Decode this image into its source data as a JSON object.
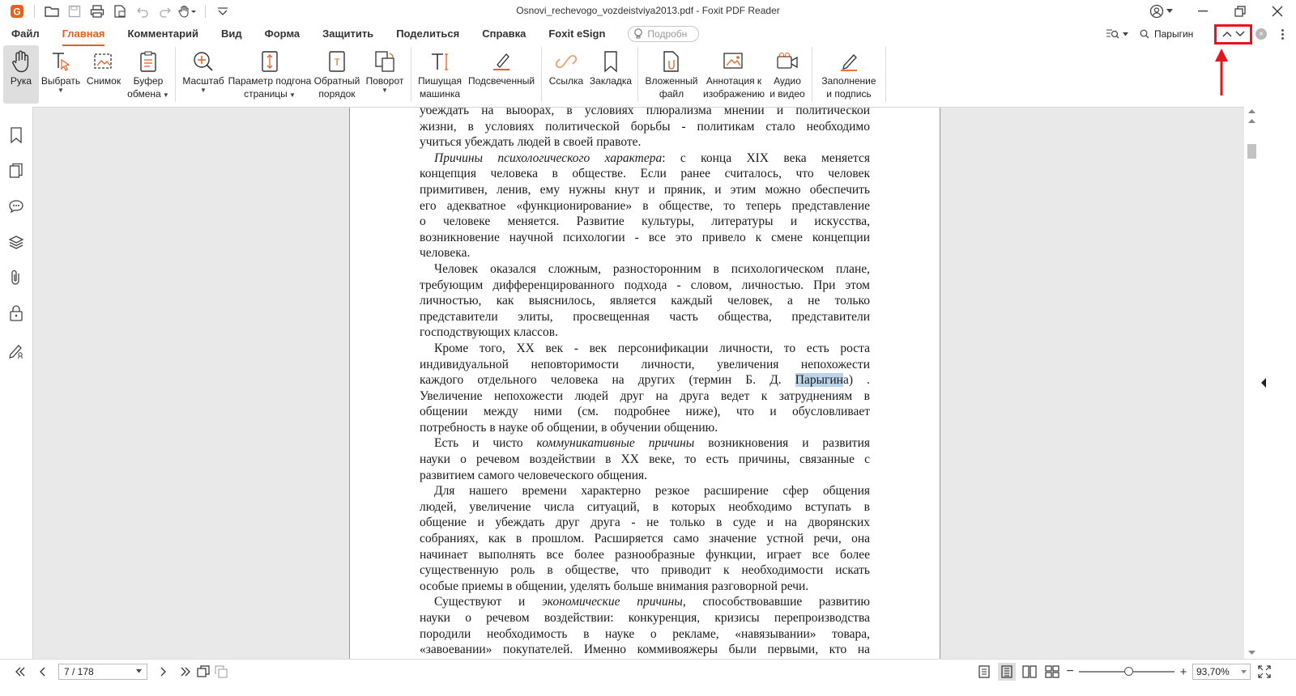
{
  "window": {
    "title": "Osnovi_rechevogo_vozdeistviya2013.pdf - Foxit PDF Reader",
    "app_icon": "foxit-logo-icon",
    "accent": "#e8601c"
  },
  "menu": {
    "items": [
      "Файл",
      "Главная",
      "Комментарий",
      "Вид",
      "Форма",
      "Защитить",
      "Поделиться",
      "Справка",
      "Foxit eSign"
    ],
    "active": "Главная",
    "tell_me": "Подробн"
  },
  "search": {
    "value": "Парыгин",
    "highlight_color": "#e8141c"
  },
  "ribbon": {
    "hand": "Рука",
    "select": "Выбрать",
    "snapshot": "Снимок",
    "clipboard_1": "Буфер",
    "clipboard_2": "обмена",
    "zoom": "Масштаб",
    "fit_1": "Параметр подгона",
    "fit_2": "страницы",
    "reverse_1": "Обратный",
    "reverse_2": "порядок",
    "rotate": "Поворот",
    "typewriter_1": "Пишущая",
    "typewriter_2": "машинка",
    "highlight": "Подсвеченный",
    "link": "Ссылка",
    "bookmark": "Закладка",
    "embed_1": "Вложенный",
    "embed_2": "файл",
    "imgann_1": "Аннотация к",
    "imgann_2": "изображению",
    "av_1": "Аудио",
    "av_2": "и видео",
    "fill_1": "Заполнение",
    "fill_2": "и подпись"
  },
  "document": {
    "l01": "убеждать на  выборах, в условиях плюрализма мнений и политической",
    "l02": "жизни, в условиях политической  борьбы - политикам стало необходимо",
    "l03": "учиться убеждать людей в своей правоте.",
    "l04a": "Причины психологического характера",
    "l04b": ": с конца XIX века меняется",
    "l05": "концепция человека в обществе. Если ранее считалось, что человек",
    "l06": "примитивен, ленив, ему нужны кнут и пряник, и этим можно обеспечить",
    "l07": "его адекватное «функционирование» в обществе, то теперь представление",
    "l08": "о человеке меняется. Развитие культуры, литературы и искусства,",
    "l09": "возникновение научной психологии  -  все это привело к смене концепции",
    "l10": "человека.",
    "l11": "Человек оказался сложным, разносторонним в психологическом плане,",
    "l12": "требующим дифференцированного подхода - словом, личностью. При этом",
    "l13": "личностью, как выяснилось, является каждый человек, а не только",
    "l14": "представители элиты, просвещенная часть общества, представители",
    "l15": "господствующих классов.",
    "l16": "Кроме того, ХХ век - век персонификации личности, то есть роста",
    "l17": "индивидуальной неповторимости личности, увеличения непохожести",
    "l18a": "каждого отдельного человека на других (термин Б. Д. ",
    "l18b": "Парыгин",
    "l18c": "а) .",
    "l19": "Увеличение непохожести людей друг на друга ведет к затруднениям в",
    "l20": "общении между ними (см. подробнее ниже), что и обусловливает",
    "l21": "потребность в науке об общении, в обучении общению.",
    "l22a": "Есть и чисто ",
    "l22b": "коммуникативные причины",
    "l22c": " возникновения и развития",
    "l23": "науки о речевом воздействии в ХХ веке, то есть причины, связанные с",
    "l24": "развитием самого человеческого общения.",
    "l25": "Для нашего времени характерно резкое расширение сфер общения",
    "l26": "людей, увеличение числа ситуаций, в которых необходимо вступать в",
    "l27": "общение и убеждать друг друга - не только в суде и на дворянских",
    "l28": "собраниях, как в прошлом. Расширяется само значение устной  речи, она",
    "l29": "начинает выполнять все более разнообразные функции, играет все более",
    "l30": "существенную роль в обществе, что приводит к необходимости искать",
    "l31": "особые приемы в общении, уделять больше внимания разговорной речи.",
    "l32a": "Существуют и ",
    "l32b": "экономические причины",
    "l32c": ", способствовавшие развитию",
    "l33": "науки о речевом воздействии: конкуренция, кризисы перепроизводства",
    "l34": "породили необходимость в науке о рекламе, «навязывании» товара,",
    "l35": "«завоевании» покупателей. Именно коммивояжеры были первыми, кто на"
  },
  "status": {
    "page": "7 / 178",
    "zoom": "93,70%",
    "zoom_level": 0.52
  }
}
